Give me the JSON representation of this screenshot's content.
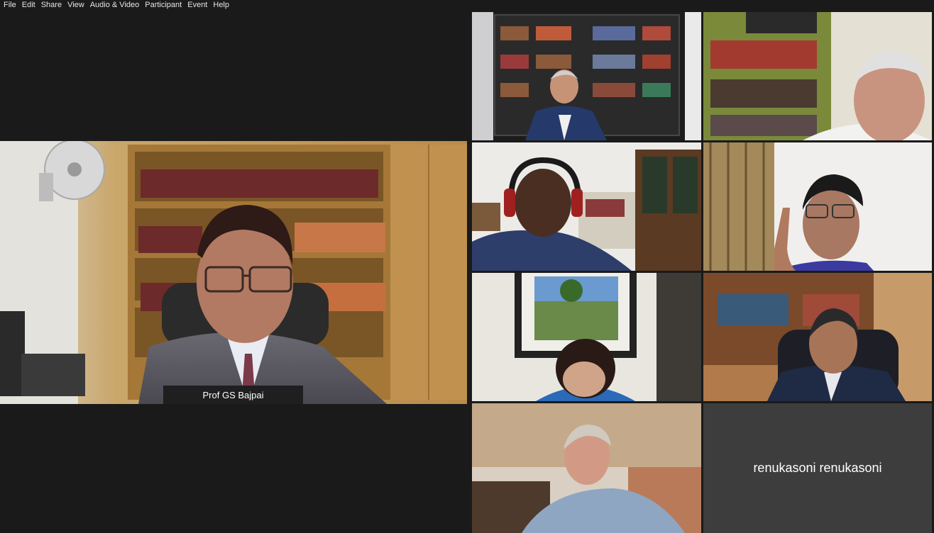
{
  "menu": {
    "items": [
      "File",
      "Edit",
      "Share",
      "View",
      "Audio & Video",
      "Participant",
      "Event",
      "Help"
    ]
  },
  "active_speaker": {
    "name": "Prof GS Bajpai"
  },
  "gallery": {
    "camera_off_name": "renukasoni renukasoni"
  },
  "colors": {
    "background": "#1a1a1a",
    "nametag_bg": "#1f1f1f",
    "camera_off_tile": "#3d3d3d"
  }
}
